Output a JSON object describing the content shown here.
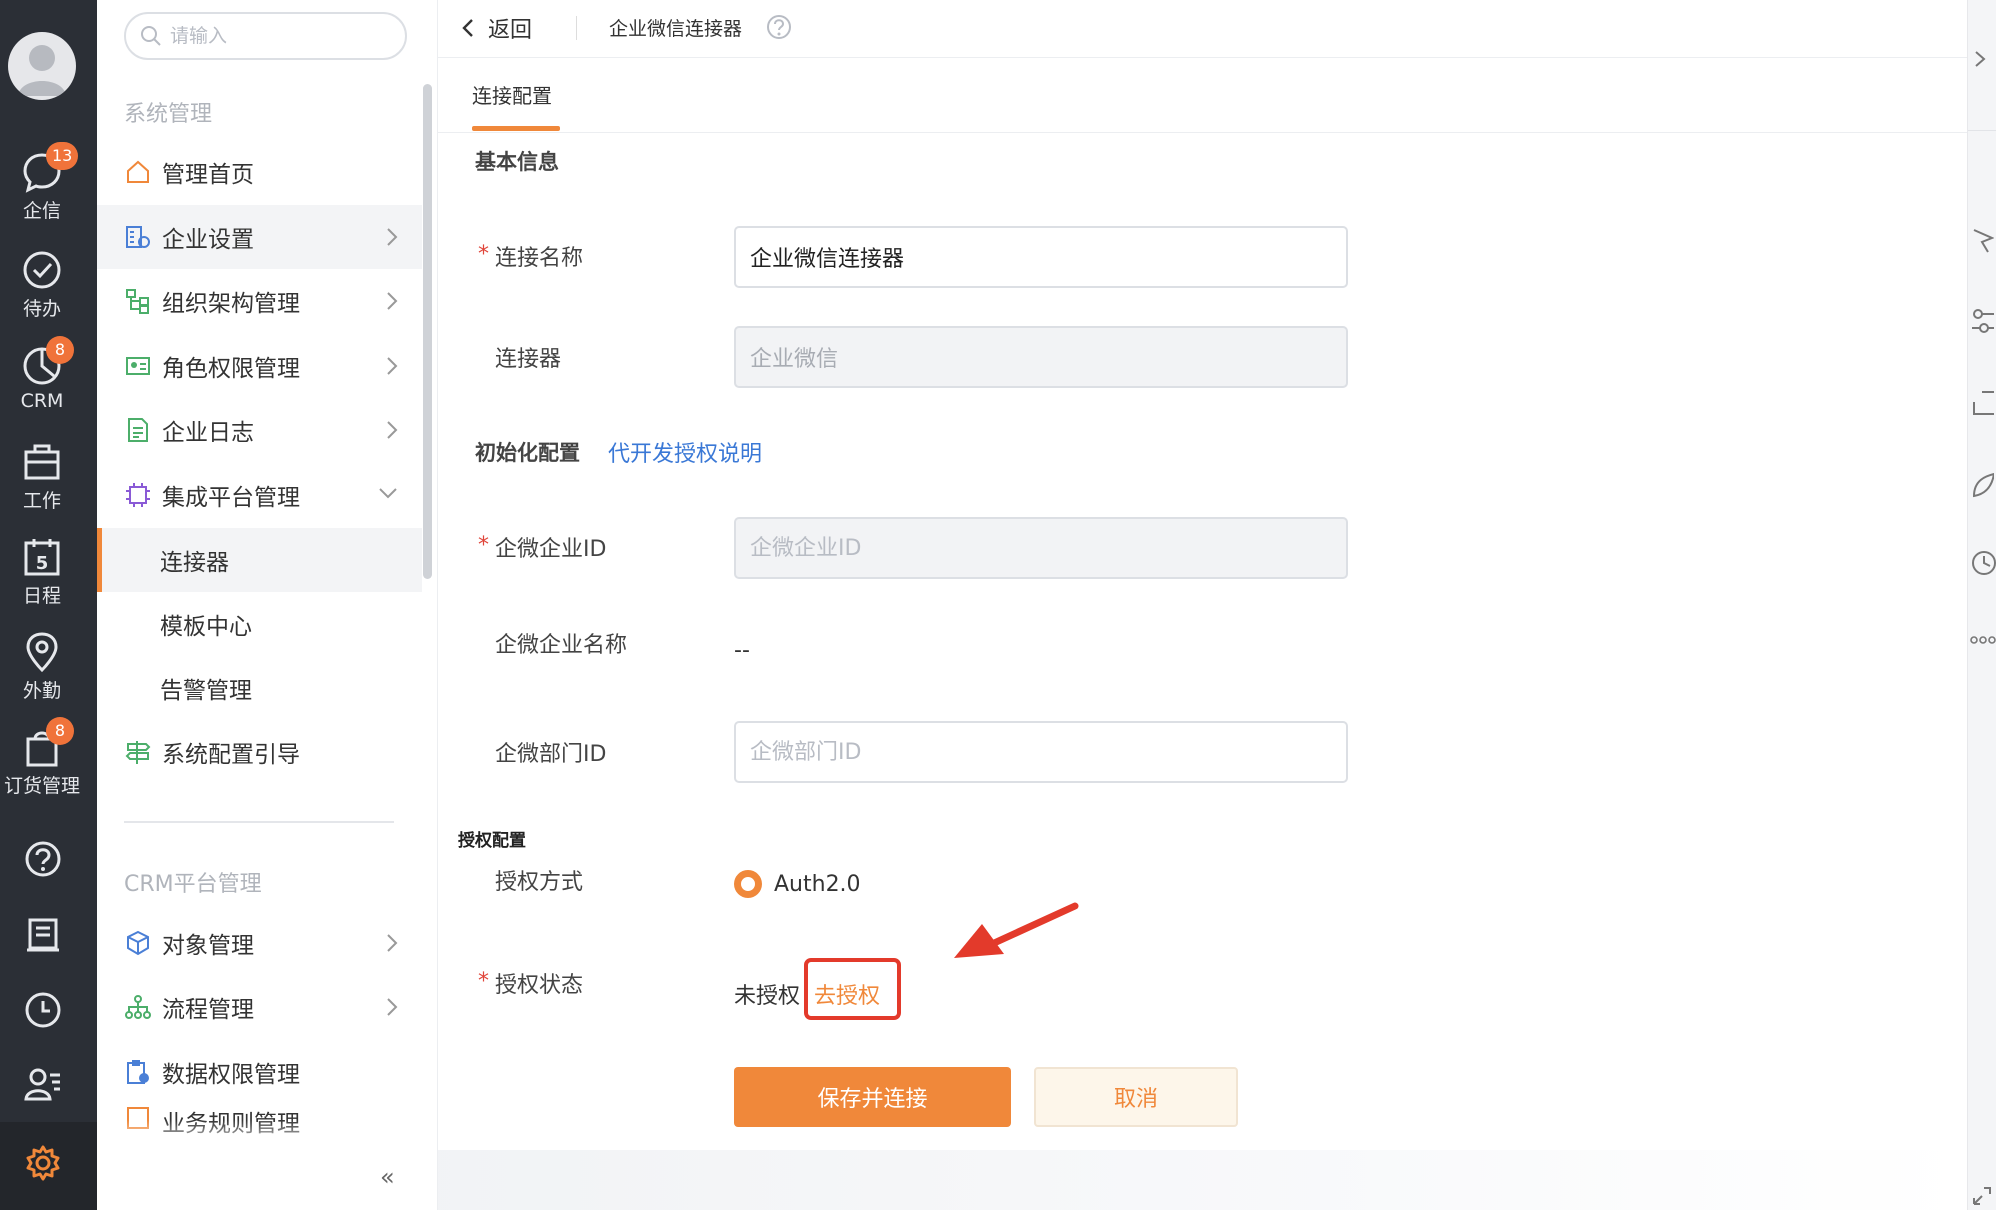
{
  "rail": {
    "items": [
      {
        "label": "企信",
        "badge": "13",
        "icon": "chat-icon"
      },
      {
        "label": "待办",
        "badge": "",
        "icon": "check-circle-icon"
      },
      {
        "label": "CRM",
        "badge": "8",
        "icon": "pie-chart-icon"
      },
      {
        "label": "工作",
        "badge": "",
        "icon": "briefcase-icon"
      },
      {
        "label": "日程",
        "badge": "",
        "icon": "calendar-icon",
        "day": "5"
      },
      {
        "label": "外勤",
        "badge": "",
        "icon": "location-pin-icon"
      },
      {
        "label": "订货管理",
        "badge": "8",
        "icon": "shopping-bag-icon"
      }
    ],
    "bottom_icons": [
      "help-icon",
      "notebook-icon",
      "clock-icon",
      "user-list-icon",
      "gear-icon"
    ]
  },
  "sidebar": {
    "search_placeholder": "请输入",
    "section1_title": "系统管理",
    "section2_title": "CRM平台管理",
    "items": [
      {
        "label": "管理首页"
      },
      {
        "label": "企业设置"
      },
      {
        "label": "组织架构管理"
      },
      {
        "label": "角色权限管理"
      },
      {
        "label": "企业日志"
      },
      {
        "label": "集成平台管理"
      },
      {
        "label": "连接器"
      },
      {
        "label": "模板中心"
      },
      {
        "label": "告警管理"
      },
      {
        "label": "系统配置引导"
      },
      {
        "label": "对象管理"
      },
      {
        "label": "流程管理"
      },
      {
        "label": "数据权限管理"
      },
      {
        "label": "业务规则管理"
      }
    ],
    "collapse_label": "«"
  },
  "header": {
    "back_label": "返回",
    "breadcrumb": "企业微信连接器"
  },
  "tabs": [
    {
      "label": "连接配置"
    }
  ],
  "form": {
    "basic_title": "基本信息",
    "conn_name_label": "连接名称",
    "conn_name_value": "企业微信连接器",
    "connector_label": "连接器",
    "connector_value": "企业微信",
    "init_title": "初始化配置",
    "init_link": "代开发授权说明",
    "corp_id_label": "企微企业ID",
    "corp_id_placeholder": "企微企业ID",
    "corp_name_label": "企微企业名称",
    "corp_name_value": "--",
    "dept_id_label": "企微部门ID",
    "dept_id_placeholder": "企微部门ID",
    "auth_title": "授权配置",
    "auth_method_label": "授权方式",
    "auth_method_value": "Auth2.0",
    "auth_status_label": "授权状态",
    "auth_status_value": "未授权",
    "auth_action": "去授权",
    "required_mark": "*",
    "save_button": "保存并连接",
    "cancel_button": "取消"
  },
  "colors": {
    "accent": "#f0883a",
    "link": "#3a78d6",
    "rail_bg": "#2b2f36",
    "badge": "#f0733a",
    "annotation": "#e33a2b"
  }
}
